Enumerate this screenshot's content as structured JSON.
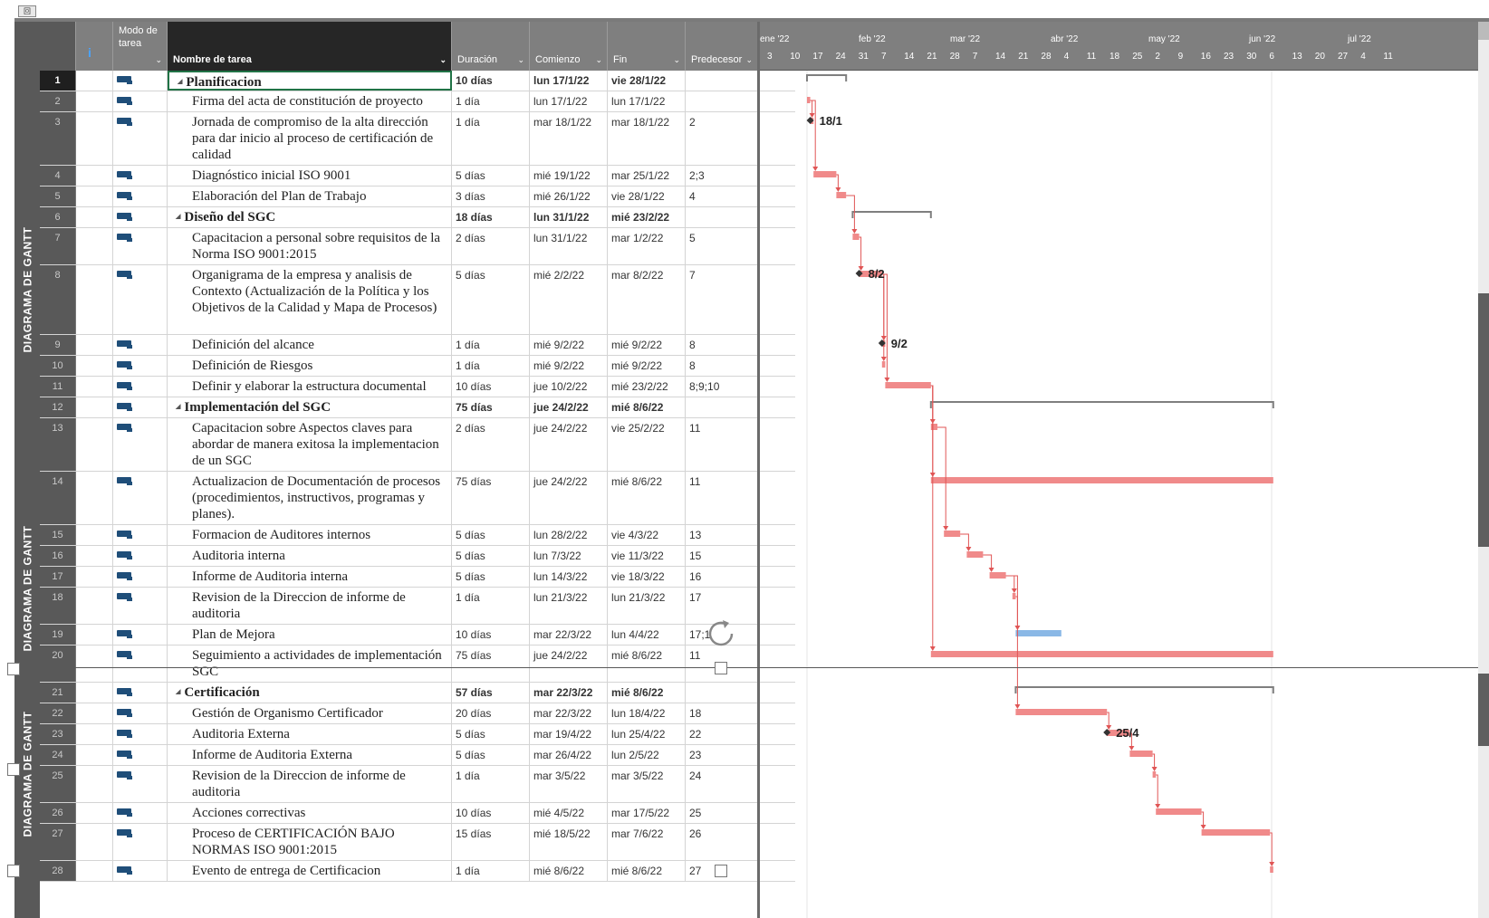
{
  "window": {
    "corner_label": "回"
  },
  "side_labels": [
    "DIAGRAMA DE GANTT",
    "DIAGRAMA DE GANTT",
    "DIAGRAMA DE GANTT"
  ],
  "columns": {
    "info": "i",
    "mode": "Modo de tarea",
    "name": "Nombre de tarea",
    "duration": "Duración",
    "start": "Comienzo",
    "finish": "Fin",
    "predecessors": "Predecesor"
  },
  "timescale": {
    "months": [
      "ene '22",
      "feb '22",
      "mar '22",
      "abr '22",
      "may '22",
      "jun '22",
      "jul '22"
    ],
    "weeks": [
      "3",
      "10",
      "17",
      "24",
      "31",
      "7",
      "14",
      "21",
      "28",
      "7",
      "14",
      "21",
      "28",
      "4",
      "11",
      "18",
      "25",
      "2",
      "9",
      "16",
      "23",
      "30",
      "6",
      "13",
      "20",
      "27",
      "4",
      "11"
    ]
  },
  "tasks": [
    {
      "id": "1",
      "name": "Planificacion",
      "duration": "10 días",
      "start": "lun 17/1/22",
      "finish": "vie 28/1/22",
      "pred": "",
      "summary": true
    },
    {
      "id": "2",
      "name": "Firma del acta de constitución de proyecto",
      "duration": "1 día",
      "start": "lun 17/1/22",
      "finish": "lun 17/1/22",
      "pred": ""
    },
    {
      "id": "3",
      "name": "Jornada de compromiso de la alta dirección para dar inicio al proceso de certificación de calidad",
      "duration": "1 día",
      "start": "mar 18/1/22",
      "finish": "mar 18/1/22",
      "pred": "2"
    },
    {
      "id": "4",
      "name": "Diagnóstico inicial ISO 9001",
      "duration": "5 días",
      "start": "mié 19/1/22",
      "finish": "mar 25/1/22",
      "pred": "2;3"
    },
    {
      "id": "5",
      "name": "Elaboración del Plan de Trabajo",
      "duration": "3 días",
      "start": "mié 26/1/22",
      "finish": "vie 28/1/22",
      "pred": "4"
    },
    {
      "id": "6",
      "name": "Diseño del SGC",
      "duration": "18 días",
      "start": "lun 31/1/22",
      "finish": "mié 23/2/22",
      "pred": "",
      "summary": true
    },
    {
      "id": "7",
      "name": "Capacitacion a personal sobre requisitos de la Norma ISO 9001:2015",
      "duration": "2 días",
      "start": "lun 31/1/22",
      "finish": "mar 1/2/22",
      "pred": "5"
    },
    {
      "id": "8",
      "name": "Organigrama de la empresa y analisis de Contexto (Actualización de la Política y los Objetivos de la Calidad y Mapa de Procesos)",
      "duration": "5 días",
      "start": "mié 2/2/22",
      "finish": "mar 8/2/22",
      "pred": "7"
    },
    {
      "id": "9",
      "name": "Definición del alcance",
      "duration": "1 día",
      "start": "mié 9/2/22",
      "finish": "mié 9/2/22",
      "pred": "8"
    },
    {
      "id": "10",
      "name": "Definición de Riesgos",
      "duration": "1 día",
      "start": "mié 9/2/22",
      "finish": "mié 9/2/22",
      "pred": "8"
    },
    {
      "id": "11",
      "name": "Definir y elaborar la estructura documental",
      "duration": "10 días",
      "start": "jue 10/2/22",
      "finish": "mié 23/2/22",
      "pred": "8;9;10"
    },
    {
      "id": "12",
      "name": "Implementación del SGC",
      "duration": "75 días",
      "start": "jue 24/2/22",
      "finish": "mié 8/6/22",
      "pred": "",
      "summary": true
    },
    {
      "id": "13",
      "name": "Capacitacion sobre Aspectos claves para abordar de manera exitosa la implementacion de un SGC",
      "duration": "2 días",
      "start": "jue 24/2/22",
      "finish": "vie 25/2/22",
      "pred": "11"
    },
    {
      "id": "14",
      "name": "Actualizacion de Documentación de procesos (procedimientos, instructivos, programas y planes).",
      "duration": "75 días",
      "start": "jue 24/2/22",
      "finish": "mié 8/6/22",
      "pred": "11"
    },
    {
      "id": "15",
      "name": "Formacion de Auditores internos",
      "duration": "5 días",
      "start": "lun 28/2/22",
      "finish": "vie 4/3/22",
      "pred": "13"
    },
    {
      "id": "16",
      "name": "Auditoria interna",
      "duration": "5 días",
      "start": "lun 7/3/22",
      "finish": "vie 11/3/22",
      "pred": "15"
    },
    {
      "id": "17",
      "name": "Informe de Auditoria interna",
      "duration": "5 días",
      "start": "lun 14/3/22",
      "finish": "vie 18/3/22",
      "pred": "16"
    },
    {
      "id": "18",
      "name": "Revision de la Direccion de informe de auditoria",
      "duration": "1 día",
      "start": "lun 21/3/22",
      "finish": "lun 21/3/22",
      "pred": "17"
    },
    {
      "id": "19",
      "name": "Plan de Mejora",
      "duration": "10 días",
      "start": "mar 22/3/22",
      "finish": "lun 4/4/22",
      "pred": "17;1"
    },
    {
      "id": "20",
      "name": "Seguimiento a actividades de implementación SGC",
      "duration": "75 días",
      "start": "jue 24/2/22",
      "finish": "mié 8/6/22",
      "pred": "11"
    },
    {
      "id": "21",
      "name": "Certificación",
      "duration": "57 días",
      "start": "mar 22/3/22",
      "finish": "mié 8/6/22",
      "pred": "",
      "summary": true
    },
    {
      "id": "22",
      "name": "Gestión de Organismo Certificador",
      "duration": "20 días",
      "start": "mar 22/3/22",
      "finish": "lun 18/4/22",
      "pred": "18"
    },
    {
      "id": "23",
      "name": "Auditoria Externa",
      "duration": "5 días",
      "start": "mar 19/4/22",
      "finish": "lun 25/4/22",
      "pred": "22"
    },
    {
      "id": "24",
      "name": "Informe de Auditoria Externa",
      "duration": "5 días",
      "start": "mar 26/4/22",
      "finish": "lun 2/5/22",
      "pred": "23"
    },
    {
      "id": "25",
      "name": "Revision de la Direccion de informe de auditoria",
      "duration": "1 día",
      "start": "mar 3/5/22",
      "finish": "mar 3/5/22",
      "pred": "24"
    },
    {
      "id": "26",
      "name": "Acciones correctivas",
      "duration": "10 días",
      "start": "mié 4/5/22",
      "finish": "mar 17/5/22",
      "pred": "25"
    },
    {
      "id": "27",
      "name": "Proceso de CERTIFICACIÓN BAJO NORMAS ISO 9001:2015",
      "duration": "15 días",
      "start": "mié 18/5/22",
      "finish": "mar 7/6/22",
      "pred": "26"
    },
    {
      "id": "28",
      "name": "Evento de entrega de Certificacion",
      "duration": "1 día",
      "start": "mié 8/6/22",
      "finish": "mié 8/6/22",
      "pred": "27"
    }
  ],
  "milestone_labels": [
    "18/1",
    "8/2",
    "9/2",
    "25/4"
  ],
  "colors": {
    "bar": "#f08a8a",
    "bar_highlight": "#8ab8e6",
    "summary": "#7f7f7f",
    "link": "#e05555",
    "header": "#7f7f7f",
    "id_column": "#595959"
  }
}
